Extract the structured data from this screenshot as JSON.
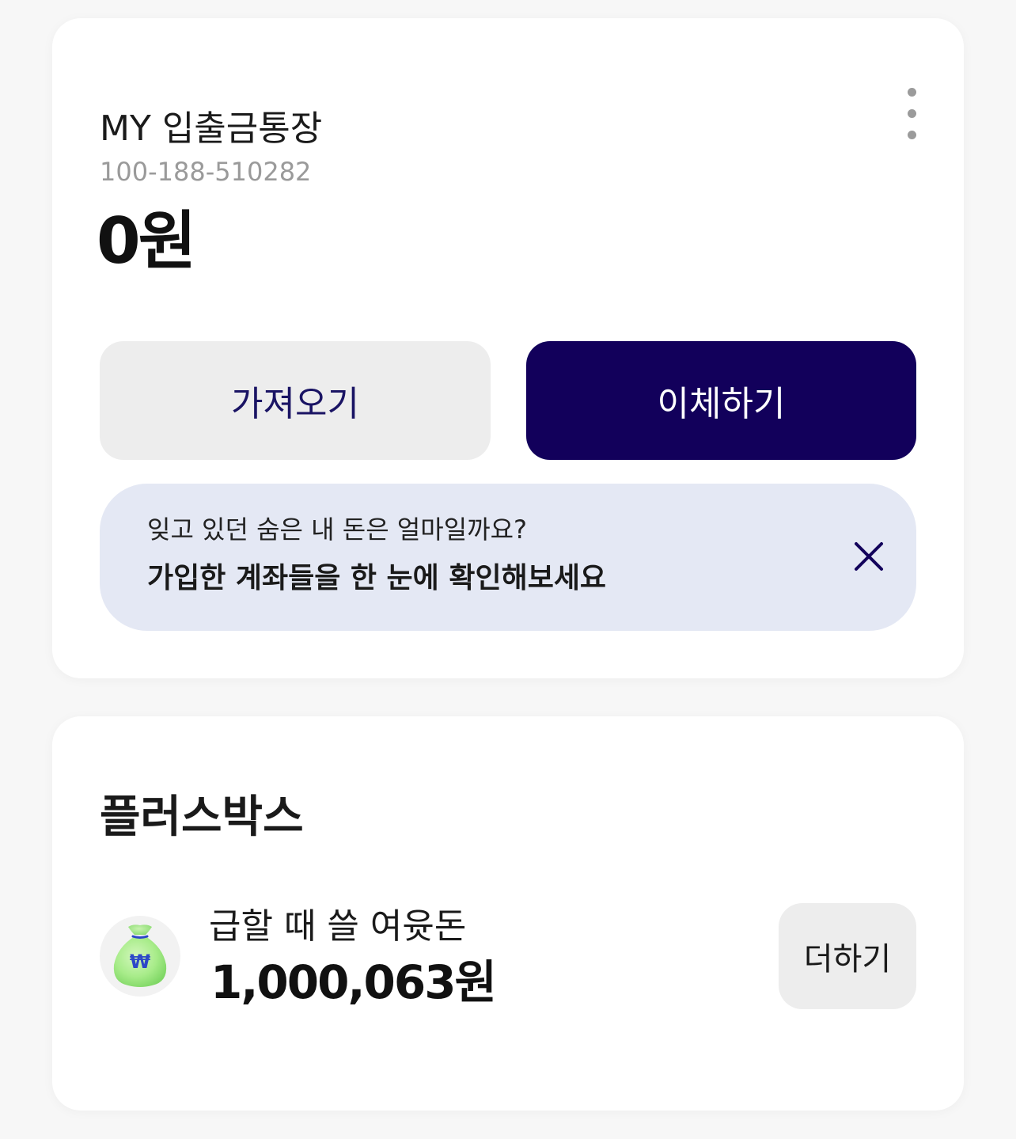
{
  "account": {
    "name": "MY 입출금통장",
    "number": "100-188-510282",
    "balance": "0원",
    "more_icon": "more-vertical-icon",
    "buttons": {
      "bring": "가져오기",
      "transfer": "이체하기"
    },
    "banner": {
      "subtitle": "잊고 있던 숨은 내 돈은 얼마일까요?",
      "title": "가입한 계좌들을 한 눈에 확인해보세요",
      "close_icon": "close-icon"
    }
  },
  "plus_box": {
    "title": "플러스박스",
    "items": [
      {
        "icon": "money-bag-icon",
        "icon_symbol": "₩",
        "name": "급할 때 쓸 여윳돈",
        "amount": "1,000,063원",
        "add_label": "더하기"
      }
    ]
  },
  "colors": {
    "primary": "#12005b",
    "secondary_button": "#ededed",
    "banner_bg": "#e4e8f4",
    "page_bg": "#f7f7f7",
    "muted_text": "#9a9a9a",
    "money_bag_green": "#a8ec8a"
  }
}
